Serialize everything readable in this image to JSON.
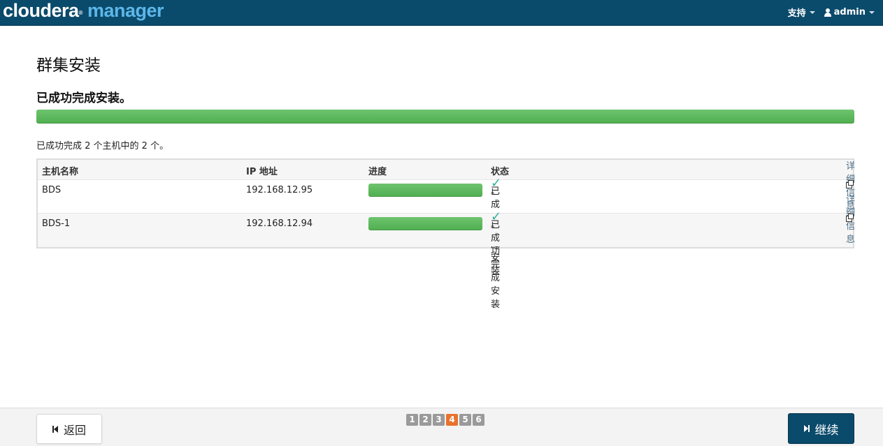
{
  "header": {
    "brand_part1": "cloudera",
    "brand_reg": "®",
    "brand_part2": "manager",
    "support_label": "支持",
    "user_label": "admin"
  },
  "main": {
    "title": "群集安装",
    "subtitle": "已成功完成安装。",
    "overall_progress": 1.0,
    "summary": "已成功完成 2 个主机中的 2 个。"
  },
  "table": {
    "headers": [
      "主机名称",
      "IP 地址",
      "进度",
      "状态"
    ],
    "rows": [
      {
        "host": "BDS",
        "ip": "192.168.12.95",
        "progress": 1.0,
        "status": "已成功完成安装",
        "status_suffix": "。",
        "detail": "详细信息"
      },
      {
        "host": "BDS-1",
        "ip": "192.168.12.94",
        "progress": 1.0,
        "status": "已成功完成安装",
        "status_suffix": "。",
        "detail": "详细信息"
      }
    ]
  },
  "footer": {
    "back_label": "返回",
    "next_label": "继续",
    "steps": [
      "1",
      "2",
      "3",
      "4",
      "5",
      "6"
    ],
    "current_step": "4"
  },
  "icons": {
    "check": "check-icon",
    "external": "external-link-icon",
    "user": "user-icon"
  },
  "colors": {
    "header_bg": "#0a4a6b",
    "brand_accent": "#5cb7e8",
    "progress_green": "#5cb85c",
    "check_teal": "#2bb39a",
    "active_step": "#e9722e"
  }
}
